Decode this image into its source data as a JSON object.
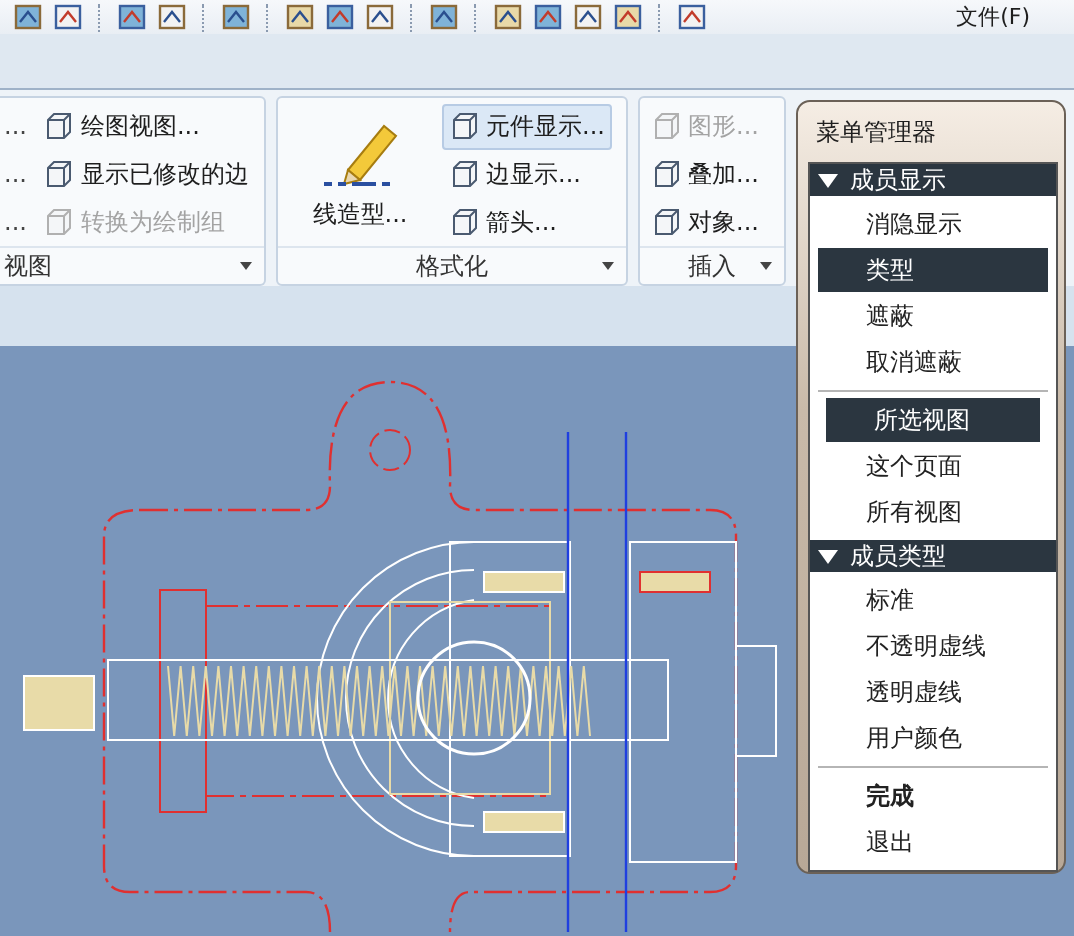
{
  "toolbar": {
    "menu": "文件(F)"
  },
  "ribbon": {
    "groups": [
      {
        "label": "视图",
        "columns": [
          [
            {
              "label": "...",
              "kind": "cut",
              "disabled": false,
              "hover": false
            },
            {
              "label": "...",
              "kind": "cut",
              "disabled": false,
              "hover": false
            },
            {
              "label": "...",
              "kind": "cut",
              "disabled": false,
              "hover": false
            }
          ],
          [
            {
              "label": "绘图视图...",
              "kind": "small",
              "disabled": false,
              "hover": false
            },
            {
              "label": "显示已修改的边",
              "kind": "small",
              "disabled": false,
              "hover": false
            },
            {
              "label": "转换为绘制组",
              "kind": "small",
              "disabled": true,
              "hover": false
            }
          ]
        ]
      },
      {
        "label": "格式化",
        "columns": [
          [
            {
              "label": "线造型...",
              "kind": "large",
              "disabled": false,
              "hover": false
            }
          ],
          [
            {
              "label": "元件显示...",
              "kind": "small",
              "disabled": false,
              "hover": true
            },
            {
              "label": "边显示...",
              "kind": "small",
              "disabled": false,
              "hover": false
            },
            {
              "label": "箭头...",
              "kind": "small",
              "disabled": false,
              "hover": false
            }
          ]
        ]
      },
      {
        "label": "插入",
        "columns": [
          [
            {
              "label": "图形...",
              "kind": "small",
              "disabled": true,
              "hover": false
            },
            {
              "label": "叠加...",
              "kind": "small",
              "disabled": false,
              "hover": false
            },
            {
              "label": "对象...",
              "kind": "small",
              "disabled": false,
              "hover": false
            }
          ]
        ]
      }
    ]
  },
  "menu_manager": {
    "title": "菜单管理器",
    "sections": [
      {
        "header": "成员显示",
        "expanded": true,
        "groups": [
          [
            {
              "label": "消隐显示",
              "selected": false
            },
            {
              "label": "类型",
              "selected": true
            },
            {
              "label": "遮蔽",
              "selected": false
            },
            {
              "label": "取消遮蔽",
              "selected": false
            }
          ],
          [
            {
              "label": "所选视图",
              "selected": true
            },
            {
              "label": "这个页面",
              "selected": false
            },
            {
              "label": "所有视图",
              "selected": false
            }
          ]
        ]
      },
      {
        "header": "成员类型",
        "expanded": true,
        "groups": [
          [
            {
              "label": "标准",
              "selected": false
            },
            {
              "label": "不透明虚线",
              "selected": false
            },
            {
              "label": "透明虚线",
              "selected": false
            },
            {
              "label": "用户颜色",
              "selected": false
            }
          ]
        ]
      }
    ],
    "actions": [
      {
        "label": "完成",
        "default": true
      },
      {
        "label": "退出",
        "default": false
      }
    ]
  }
}
